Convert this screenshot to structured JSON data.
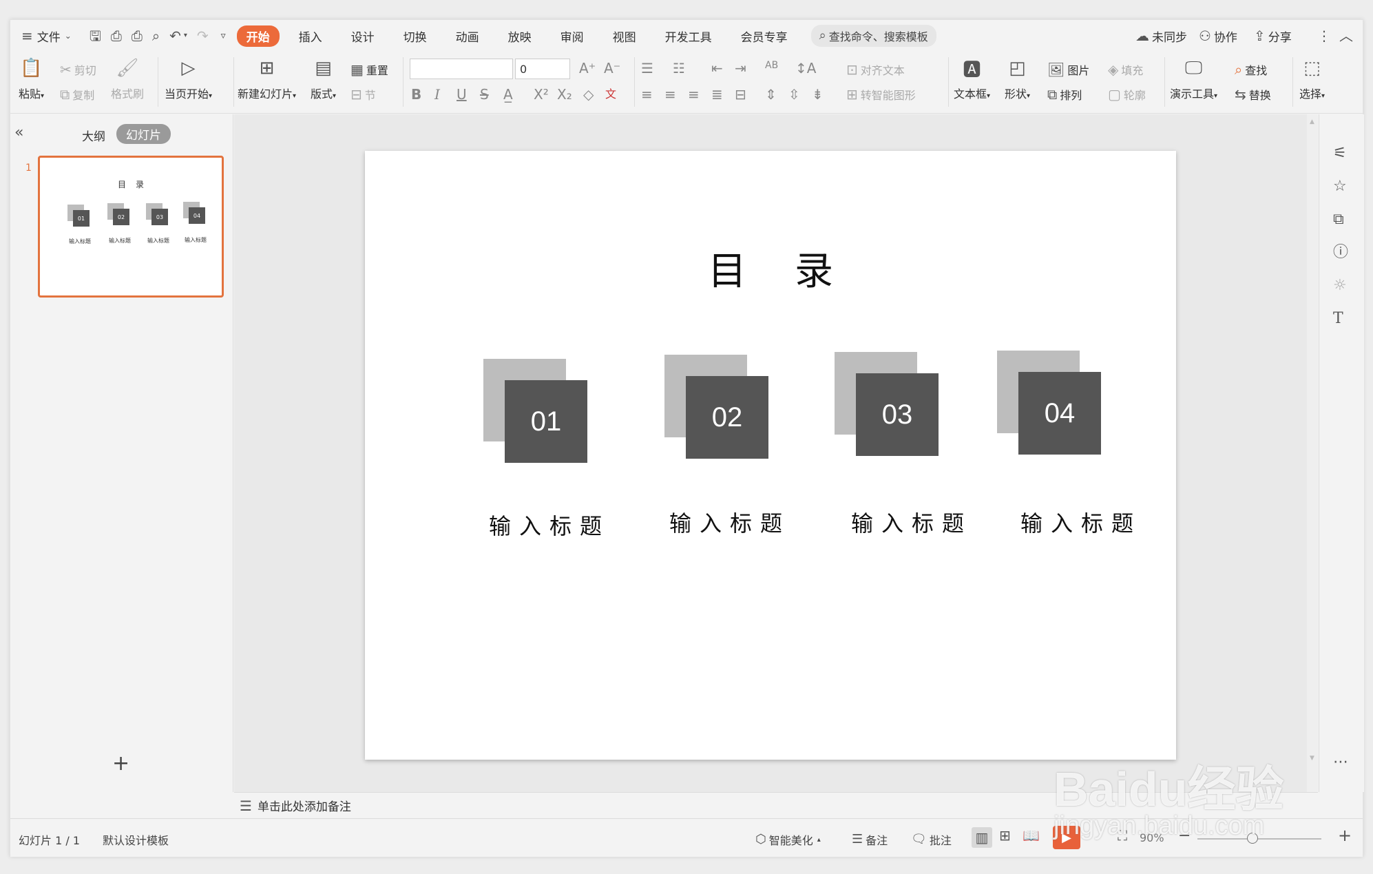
{
  "menubar": {
    "file": "文件",
    "tabs": [
      "开始",
      "插入",
      "设计",
      "切换",
      "动画",
      "放映",
      "审阅",
      "视图",
      "开发工具",
      "会员专享"
    ],
    "search": "查找命令、搜索模板",
    "sync": "未同步",
    "collab": "协作",
    "share": "分享"
  },
  "ribbon": {
    "paste": "粘贴",
    "cut": "剪切",
    "copy": "复制",
    "format_painter": "格式刷",
    "play_current": "当页开始",
    "new_slide": "新建幻灯片",
    "layout": "版式",
    "reset": "重置",
    "section": "节",
    "font_size": "0",
    "align_text": "对齐文本",
    "smart_graphic": "转智能图形",
    "textbox": "文本框",
    "shape": "形状",
    "picture": "图片",
    "fill": "填充",
    "arrange": "排列",
    "outline": "轮廓",
    "presenter_tools": "演示工具",
    "find": "查找",
    "replace": "替换",
    "select": "选择"
  },
  "leftpanel": {
    "outline_tab": "大纲",
    "slides_tab": "幻灯片",
    "slide_number": "1"
  },
  "slide": {
    "title": "目录",
    "items": [
      {
        "num": "01",
        "caption": "输入标题"
      },
      {
        "num": "02",
        "caption": "输入标题"
      },
      {
        "num": "03",
        "caption": "输入标题"
      },
      {
        "num": "04",
        "caption": "输入标题"
      }
    ]
  },
  "notes": {
    "placeholder": "单击此处添加备注"
  },
  "status": {
    "slide_counter": "幻灯片 1 / 1",
    "template": "默认设计模板",
    "beautify": "智能美化",
    "notes": "备注",
    "comments": "批注",
    "zoom": "90%"
  },
  "watermark": {
    "brand": "Baidu经验",
    "url": "jingyan.baidu.com"
  },
  "colors": {
    "accent": "#ec6a3a",
    "box_dark": "#555555",
    "box_light": "#bdbdbd"
  }
}
